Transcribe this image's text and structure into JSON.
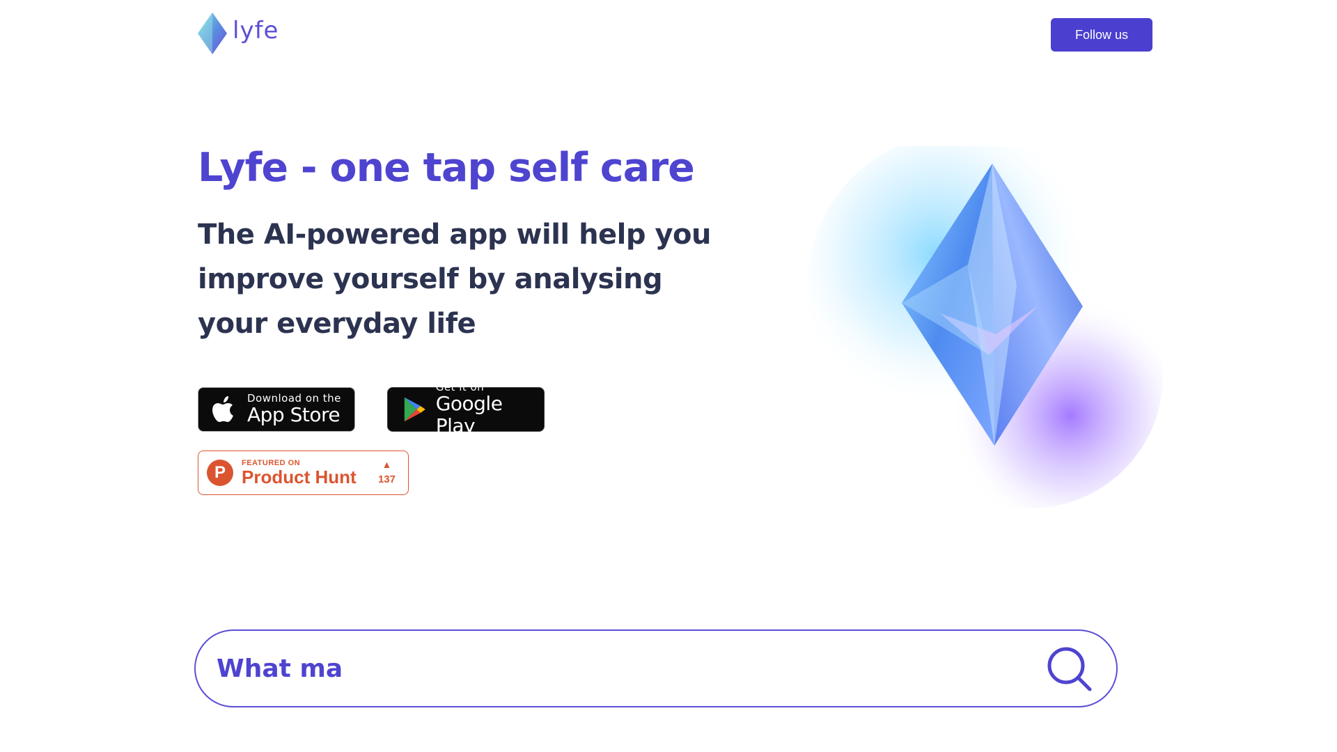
{
  "header": {
    "logo_text": "lyfe",
    "follow_label": "Follow us"
  },
  "hero": {
    "title": "Lyfe - one tap self care",
    "subtitle": "The AI-powered app will help you improve yourself by analysing your everyday life"
  },
  "stores": {
    "appstore_small": "Download on the",
    "appstore_big": "App Store",
    "googleplay_small": "Get it on",
    "googleplay_big": "Google Play"
  },
  "product_hunt": {
    "featured": "FEATURED ON",
    "name": "Product Hunt",
    "votes": "137"
  },
  "search": {
    "value": "What ma"
  },
  "colors": {
    "accent": "#4e44d0",
    "button": "#4a3fcf",
    "text_dark": "#2c3350",
    "product_hunt": "#da552f"
  },
  "icons": [
    "lyfe-gem-logo-icon",
    "apple-icon",
    "google-play-icon",
    "product-hunt-icon",
    "upvote-arrow-icon",
    "search-icon",
    "crystal-illustration"
  ]
}
